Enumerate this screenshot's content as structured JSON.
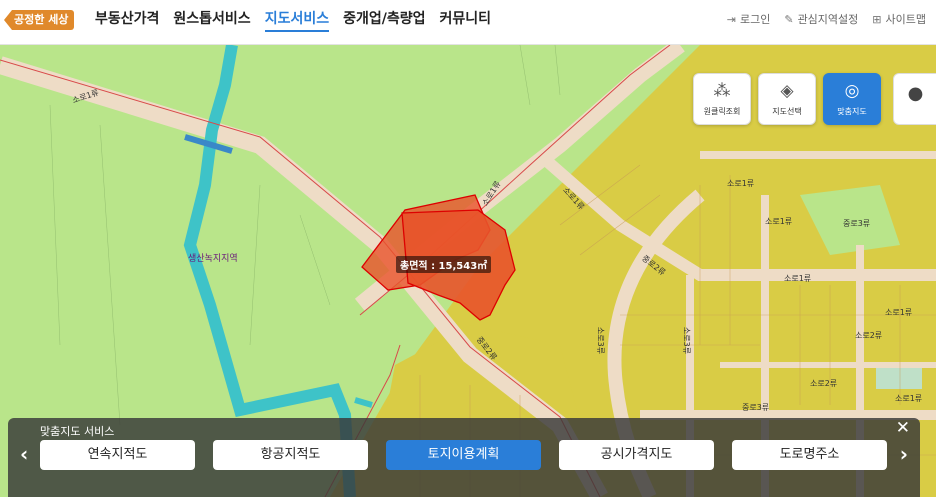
{
  "header": {
    "logo_text": "공정한 세상",
    "nav": [
      "부동산가격",
      "원스톱서비스",
      "지도서비스",
      "중개업/측량업",
      "커뮤니티"
    ],
    "active_nav_index": 2,
    "util": [
      {
        "label": "로그인",
        "icon": "login-icon"
      },
      {
        "label": "관심지역설정",
        "icon": "pin-icon"
      },
      {
        "label": "사이트맵",
        "icon": "sitemap-icon"
      }
    ]
  },
  "map": {
    "road_labels": [
      "소로1류",
      "소로1류",
      "소로1류",
      "소로1류",
      "소로1류",
      "중로3류",
      "중로2류",
      "중로2류",
      "소로3류",
      "소로3류",
      "소로1류",
      "소로2류",
      "소로2류",
      "소로1류",
      "중로3류",
      "소로1류"
    ],
    "zone_label": "생산녹지지역",
    "area_label": "총면적 : 15,543㎡"
  },
  "tools": [
    {
      "label": "원클릭조회",
      "icon": "cursor-click-icon"
    },
    {
      "label": "지도선택",
      "icon": "layers-icon"
    },
    {
      "label": "맞춤지도",
      "icon": "target-icon",
      "active": true
    }
  ],
  "panel": {
    "title": "맞춤지도 서비스",
    "buttons": [
      "연속지적도",
      "항공지적도",
      "토지이용계획",
      "공시가격지도",
      "도로명주소"
    ],
    "active_index": 2
  },
  "colors": {
    "accent": "#2a7ed8",
    "green_zone": "#b9e58a",
    "yellow_zone": "#d9cc45",
    "parcel_red": "#e8532a"
  }
}
